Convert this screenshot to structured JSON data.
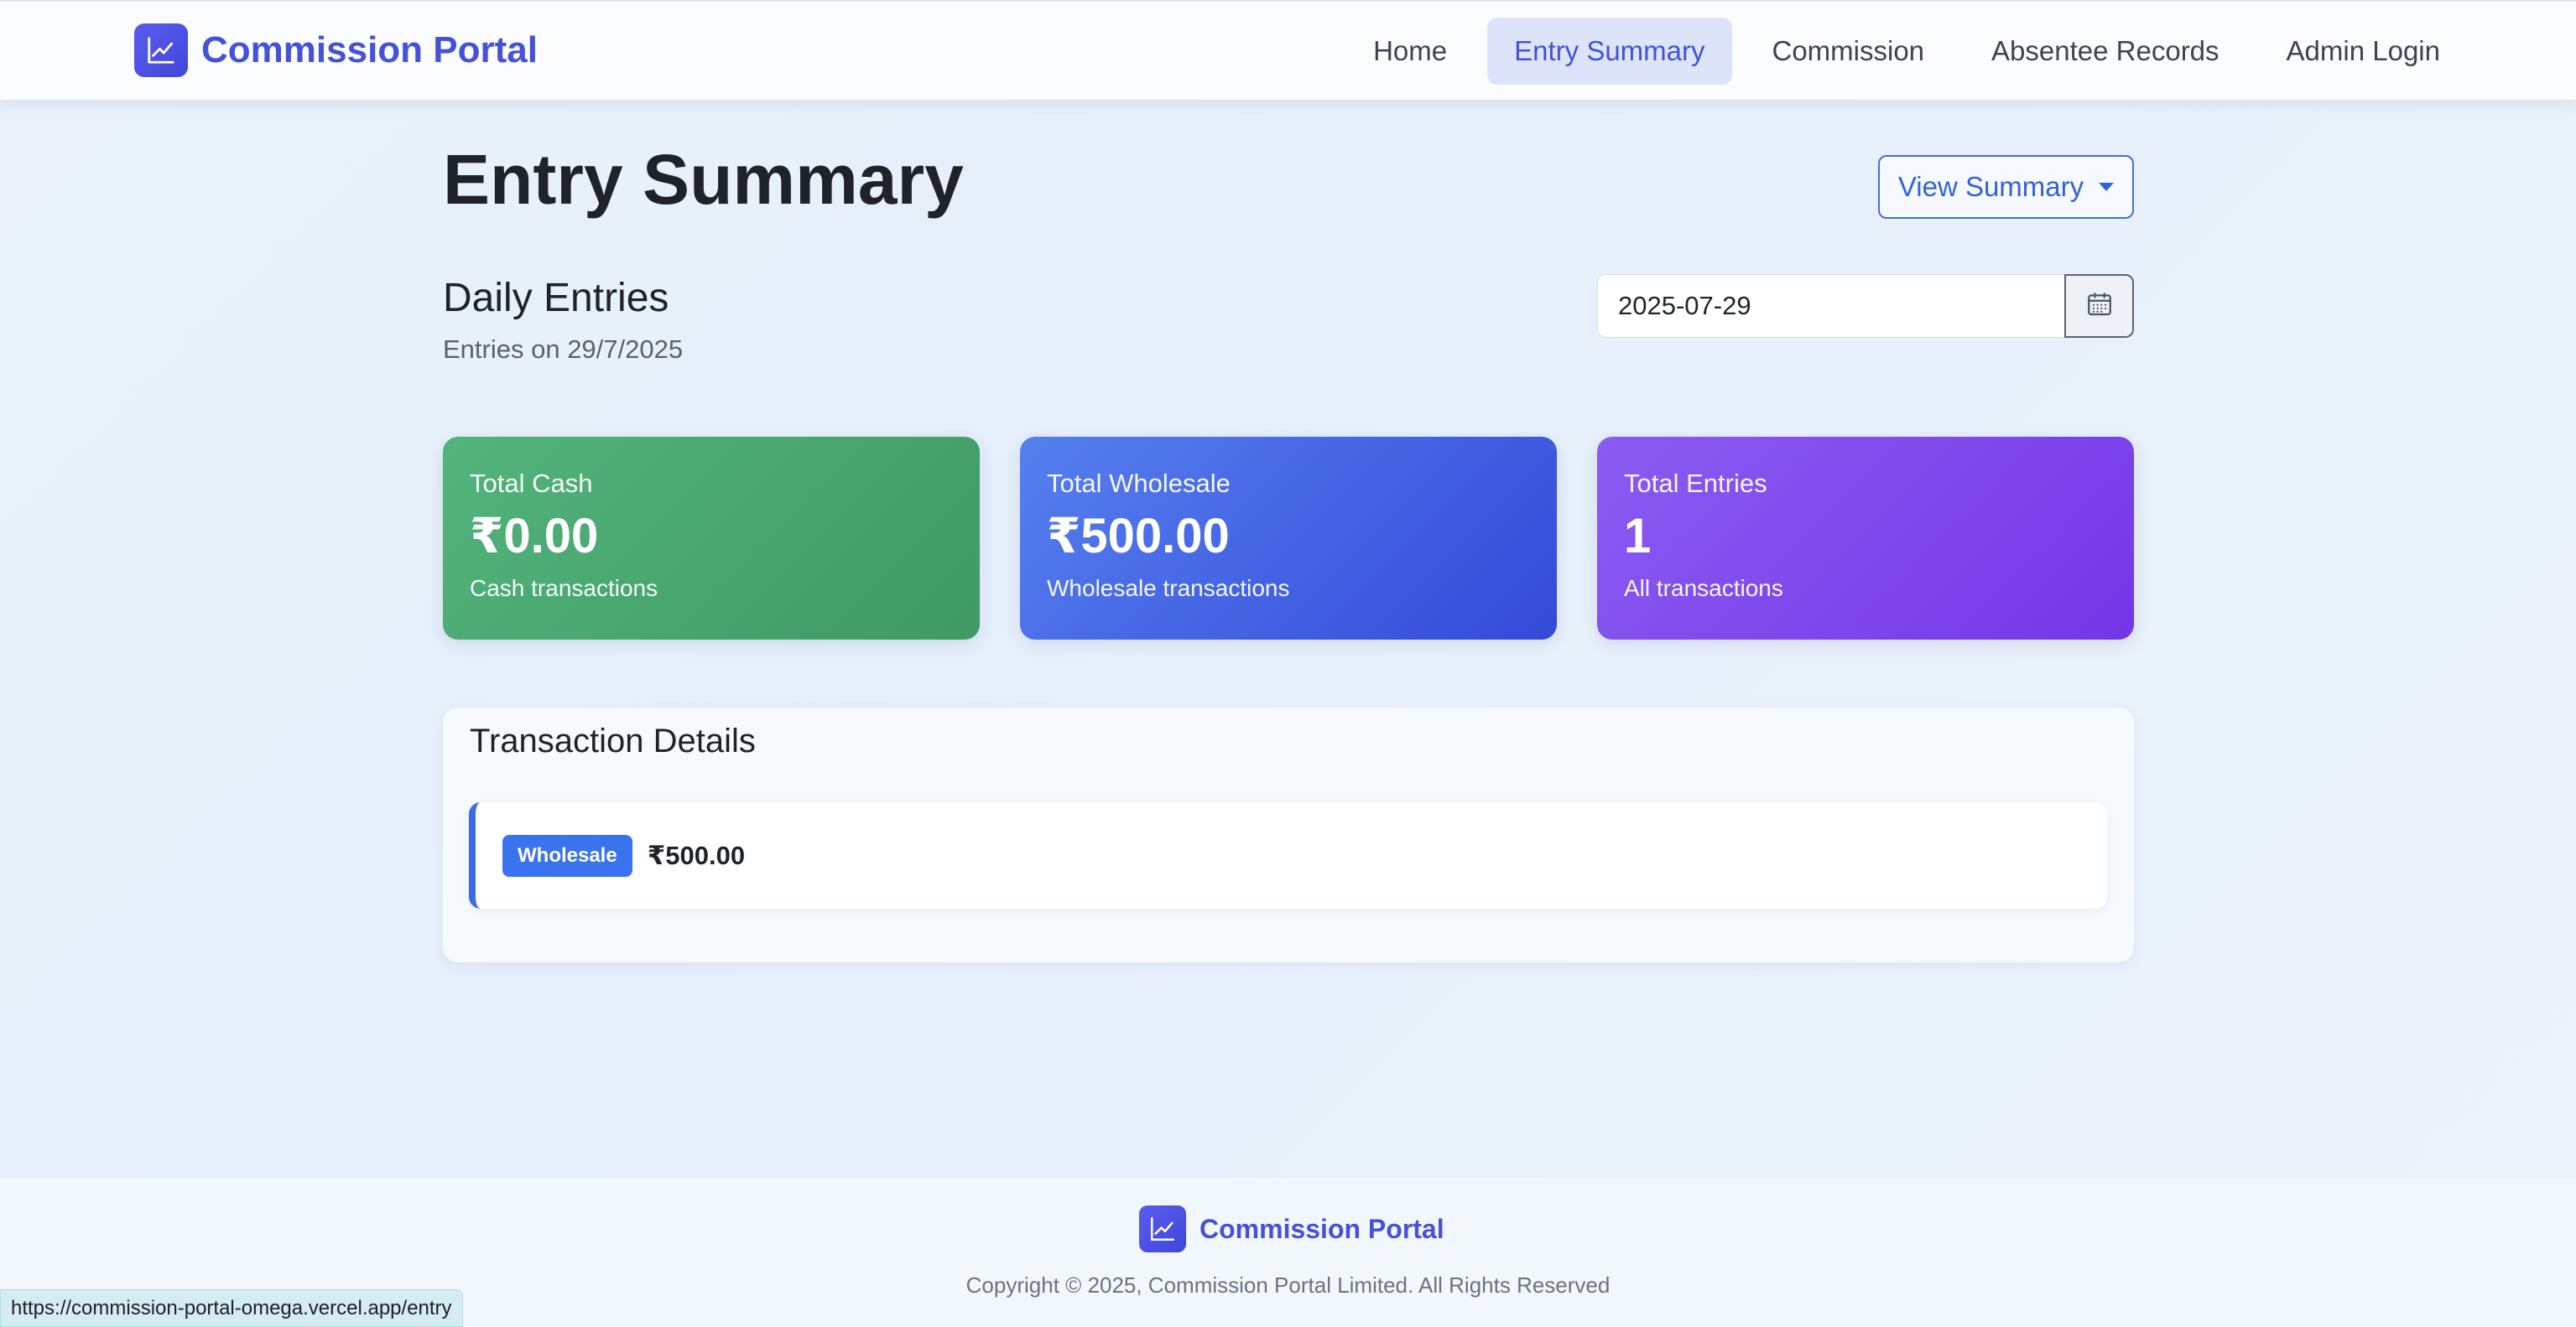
{
  "navbar": {
    "brand": "Commission Portal",
    "brand_icon": "chart-line-icon",
    "items": [
      {
        "label": "Home",
        "active": false
      },
      {
        "label": "Entry Summary",
        "active": true
      },
      {
        "label": "Commission",
        "active": false
      },
      {
        "label": "Absentee Records",
        "active": false
      },
      {
        "label": "Admin Login",
        "active": false
      }
    ]
  },
  "header": {
    "title": "Entry Summary",
    "view_summary_label": "View Summary"
  },
  "daily": {
    "title": "Daily Entries",
    "subtitle": "Entries on 29/7/2025",
    "date_value": "2025-07-29",
    "calendar_icon": "calendar-icon"
  },
  "cards": [
    {
      "label": "Total Cash",
      "value": "₹0.00",
      "note": "Cash transactions",
      "color": "#4caf75"
    },
    {
      "label": "Total Wholesale",
      "value": "₹500.00",
      "note": "Wholesale transactions",
      "color": "#4466e6"
    },
    {
      "label": "Total Entries",
      "value": "1",
      "note": "All transactions",
      "color": "#7f48ec"
    }
  ],
  "details": {
    "title": "Transaction Details",
    "transactions": [
      {
        "type": "Wholesale",
        "amount": "₹500.00",
        "color": "#3a73ee"
      }
    ]
  },
  "footer": {
    "brand": "Commission Portal",
    "copyright": "Copyright © 2025, Commission Portal Limited. All Rights Reserved"
  },
  "status_bar": {
    "url": "https://commission-portal-omega.vercel.app/entry"
  },
  "colors": {
    "brand": "#4651d9",
    "accent": "#3f6ee0",
    "active_nav_bg": "#dde4fa"
  }
}
